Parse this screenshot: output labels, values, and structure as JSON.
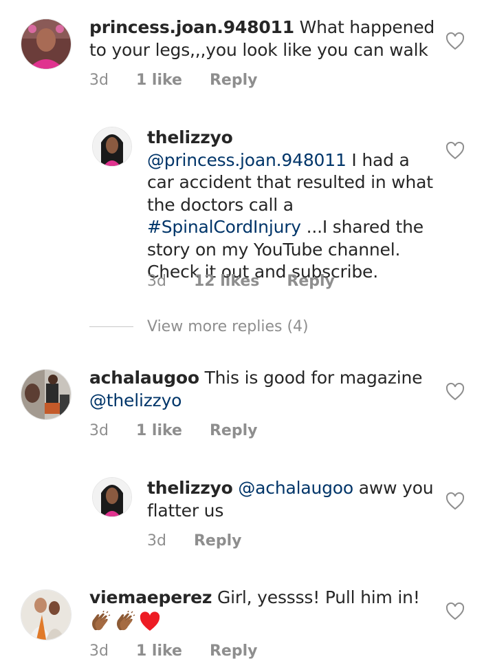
{
  "comments": [
    {
      "username": "princess.joan.948011",
      "text": "What happened to your legs,,,you look like you can walk",
      "time": "3d",
      "likes": "1 like",
      "reply": "Reply"
    },
    {
      "username": "thelizzyo",
      "mention": "@princess.joan.948011",
      "text_a": "I had a car accident that resulted in what the doctors call a",
      "hashtag": "#SpinalCordInjury",
      "text_b": "...I shared the story on my YouTube channel. Check it out and subscribe.",
      "time": "3d",
      "likes": "12 likes",
      "reply": "Reply"
    },
    {
      "username": "achalaugoo",
      "text": "This is good for  magazine",
      "mention": "@thelizzyo",
      "time": "3d",
      "likes": "1 like",
      "reply": "Reply"
    },
    {
      "username": "thelizzyo",
      "mention": "@achalaugoo",
      "text": "aww you flatter us",
      "time": "3d",
      "reply": "Reply"
    },
    {
      "username": "viemaeperez",
      "text": "Girl, yessss! Pull him in!",
      "emoji": [
        "clapping-hands-icon",
        "clapping-hands-icon",
        "red-heart-icon"
      ],
      "time": "3d",
      "likes": "1 like",
      "reply": "Reply"
    }
  ],
  "view_more": "View more replies (4)",
  "colors": {
    "text": "#262626",
    "mention": "#003569",
    "meta": "#8e8e8e",
    "heart_outline": "#8e8e8e",
    "red_heart": "#ed1c24"
  }
}
